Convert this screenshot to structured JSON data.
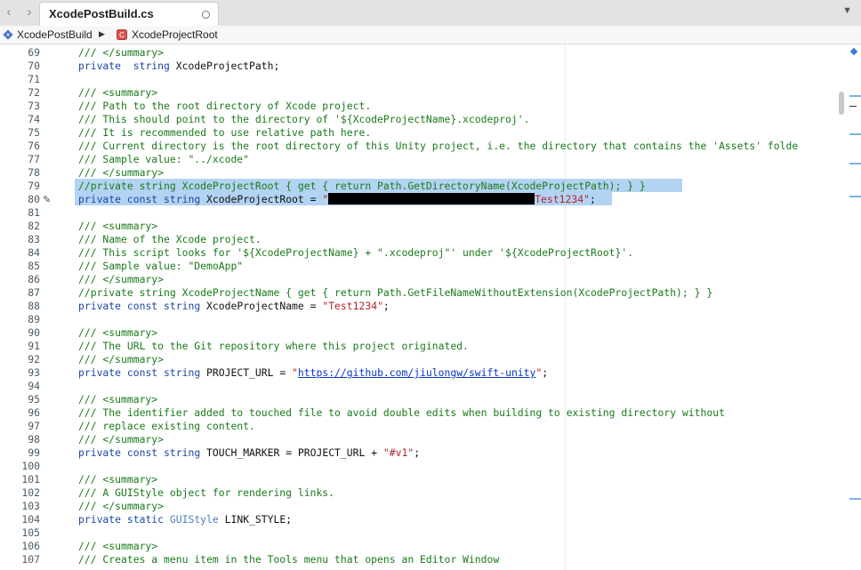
{
  "tab": {
    "title": "XcodePostBuild.cs"
  },
  "breadcrumb": {
    "item1": "XcodePostBuild",
    "item2": "XcodeProjectRoot",
    "item2_badge": "C"
  },
  "lines": [
    {
      "n": "69",
      "t": [
        [
          "cm",
          "/// </summary>"
        ]
      ]
    },
    {
      "n": "70",
      "t": [
        [
          "kw",
          "private"
        ],
        [
          "",
          "  "
        ],
        [
          "kw",
          "string"
        ],
        [
          "",
          " XcodeProjectPath;"
        ]
      ]
    },
    {
      "n": "71",
      "t": []
    },
    {
      "n": "72",
      "t": [
        [
          "cm",
          "/// <summary>"
        ]
      ]
    },
    {
      "n": "73",
      "t": [
        [
          "cm",
          "/// Path to the root directory of Xcode project."
        ]
      ]
    },
    {
      "n": "74",
      "t": [
        [
          "cm",
          "/// This should point to the directory of '${XcodeProjectName}.xcodeproj'."
        ]
      ]
    },
    {
      "n": "75",
      "t": [
        [
          "cm",
          "/// It is recommended to use relative path here."
        ]
      ]
    },
    {
      "n": "76",
      "t": [
        [
          "cm",
          "/// Current directory is the root directory of this Unity project, i.e. the directory that contains the 'Assets' folde"
        ]
      ]
    },
    {
      "n": "77",
      "t": [
        [
          "cm",
          "/// Sample value: \"../xcode\""
        ]
      ]
    },
    {
      "n": "78",
      "t": [
        [
          "cm",
          "/// </summary>"
        ]
      ]
    },
    {
      "n": "79",
      "t": [
        [
          "cm",
          "//private string XcodeProjectRoot { get { return Path.GetDirectoryName(XcodeProjectPath); } }"
        ]
      ]
    },
    {
      "n": "80",
      "t": [
        [
          "kw",
          "private"
        ],
        [
          "",
          " "
        ],
        [
          "kw",
          "const"
        ],
        [
          "",
          " "
        ],
        [
          "kw",
          "string"
        ],
        [
          "",
          " XcodeProjectRoot = "
        ],
        [
          "st",
          "\""
        ],
        [
          "redact",
          ""
        ],
        [
          "st",
          "Test1234\""
        ],
        [
          "",
          ";"
        ]
      ]
    },
    {
      "n": "81",
      "t": []
    },
    {
      "n": "82",
      "t": [
        [
          "cm",
          "/// <summary>"
        ]
      ]
    },
    {
      "n": "83",
      "t": [
        [
          "cm",
          "/// Name of the Xcode project."
        ]
      ]
    },
    {
      "n": "84",
      "t": [
        [
          "cm",
          "/// This script looks for '${XcodeProjectName} + \".xcodeproj\"' under '${XcodeProjectRoot}'."
        ]
      ]
    },
    {
      "n": "85",
      "t": [
        [
          "cm",
          "/// Sample value: \"DemoApp\""
        ]
      ]
    },
    {
      "n": "86",
      "t": [
        [
          "cm",
          "/// </summary>"
        ]
      ]
    },
    {
      "n": "87",
      "t": [
        [
          "cm",
          "//private string XcodeProjectName { get { return Path.GetFileNameWithoutExtension(XcodeProjectPath); } }"
        ]
      ]
    },
    {
      "n": "88",
      "t": [
        [
          "kw",
          "private"
        ],
        [
          "",
          " "
        ],
        [
          "kw",
          "const"
        ],
        [
          "",
          " "
        ],
        [
          "kw",
          "string"
        ],
        [
          "",
          " XcodeProjectName = "
        ],
        [
          "st",
          "\"Test1234\""
        ],
        [
          "",
          ";"
        ]
      ]
    },
    {
      "n": "89",
      "t": []
    },
    {
      "n": "90",
      "t": [
        [
          "cm",
          "/// <summary>"
        ]
      ]
    },
    {
      "n": "91",
      "t": [
        [
          "cm",
          "/// The URL to the Git repository where this project originated."
        ]
      ]
    },
    {
      "n": "92",
      "t": [
        [
          "cm",
          "/// </summary>"
        ]
      ]
    },
    {
      "n": "93",
      "t": [
        [
          "kw",
          "private"
        ],
        [
          "",
          " "
        ],
        [
          "kw",
          "const"
        ],
        [
          "",
          " "
        ],
        [
          "kw",
          "string"
        ],
        [
          "",
          " PROJECT_URL = "
        ],
        [
          "st",
          "\""
        ],
        [
          "lk",
          "https://github.com/jiulongw/swift-unity"
        ],
        [
          "st",
          "\""
        ],
        [
          "",
          ";"
        ]
      ]
    },
    {
      "n": "94",
      "t": []
    },
    {
      "n": "95",
      "t": [
        [
          "cm",
          "/// <summary>"
        ]
      ]
    },
    {
      "n": "96",
      "t": [
        [
          "cm",
          "/// The identifier added to touched file to avoid double edits when building to existing directory without"
        ]
      ]
    },
    {
      "n": "97",
      "t": [
        [
          "cm",
          "/// replace existing content."
        ]
      ]
    },
    {
      "n": "98",
      "t": [
        [
          "cm",
          "/// </summary>"
        ]
      ]
    },
    {
      "n": "99",
      "t": [
        [
          "kw",
          "private"
        ],
        [
          "",
          " "
        ],
        [
          "kw",
          "const"
        ],
        [
          "",
          " "
        ],
        [
          "kw",
          "string"
        ],
        [
          "",
          " TOUCH_MARKER = PROJECT_URL + "
        ],
        [
          "st",
          "\"#v1\""
        ],
        [
          "",
          ";"
        ]
      ]
    },
    {
      "n": "100",
      "t": []
    },
    {
      "n": "101",
      "t": [
        [
          "cm",
          "/// <summary>"
        ]
      ]
    },
    {
      "n": "102",
      "t": [
        [
          "cm",
          "/// A GUIStyle object for rendering links."
        ]
      ]
    },
    {
      "n": "103",
      "t": [
        [
          "cm",
          "/// </summary>"
        ]
      ]
    },
    {
      "n": "104",
      "t": [
        [
          "kw",
          "private"
        ],
        [
          "",
          " "
        ],
        [
          "kw",
          "static"
        ],
        [
          "",
          " "
        ],
        [
          "ty",
          "GUIStyle"
        ],
        [
          "",
          " LINK_STYLE;"
        ]
      ]
    },
    {
      "n": "105",
      "t": []
    },
    {
      "n": "106",
      "t": [
        [
          "cm",
          "/// <summary>"
        ]
      ]
    },
    {
      "n": "107",
      "t": [
        [
          "cm",
          "/// Creates a menu item in the Tools menu that opens an Editor Window"
        ]
      ]
    }
  ]
}
